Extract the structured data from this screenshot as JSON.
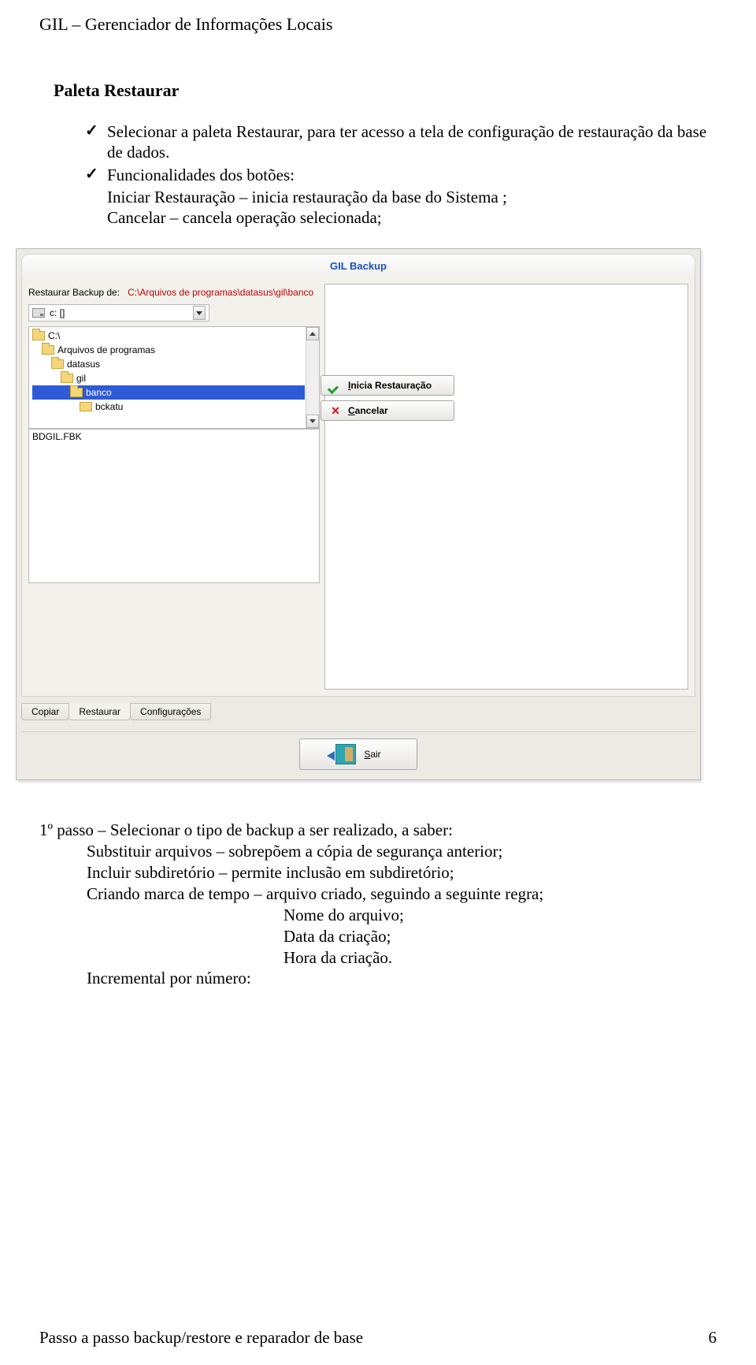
{
  "doc": {
    "header": "GIL – Gerenciador de Informações Locais",
    "section_title": "Paleta Restaurar",
    "bullets": {
      "b1": "Selecionar a paleta Restaurar, para ter acesso a tela de configuração de restauração da base de dados.",
      "b2": "Funcionalidades dos botões:",
      "b2_line1": "Iniciar Restauração – inicia restauração da base do Sistema ;",
      "b2_line2": "Cancelar – cancela operação selecionada;"
    },
    "post": {
      "l1": "1º passo – Selecionar o tipo de backup a ser realizado, a saber:",
      "l2": "Substituir arquivos – sobrepõem a cópia de segurança anterior;",
      "l3": "Incluir subdiretório – permite inclusão em subdiretório;",
      "l4": "Criando marca de tempo – arquivo criado, seguindo a seguinte regra;",
      "l5": "Nome do arquivo;",
      "l6": "Data da criação;",
      "l7": "Hora da criação.",
      "l8": "Incremental por número:"
    },
    "footer_left": "Passo a passo backup/restore e reparador de base",
    "footer_right": "6"
  },
  "app": {
    "window_title": "GIL Backup",
    "path_label": "Restaurar Backup de:",
    "path_value": "C:\\Arquivos de programas\\datasus\\gil\\banco",
    "drive_label": "c: []",
    "tree": {
      "i0": "C:\\",
      "i1": "Arquivos de programas",
      "i2": "datasus",
      "i3": "gil",
      "i4": "banco",
      "i5": "bckatu"
    },
    "file0": "BDGIL.FBK",
    "buttons": {
      "start": "Inicia Restauração",
      "cancel": "Cancelar",
      "exit": "Sair"
    },
    "bottom_tabs": {
      "t0": "Copiar",
      "t1": "Restaurar",
      "t2": "Configurações"
    }
  }
}
